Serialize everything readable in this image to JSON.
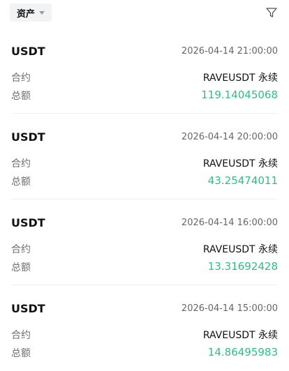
{
  "toolbar": {
    "filter_label": "资产"
  },
  "labels": {
    "contract": "合约",
    "amount": "总额"
  },
  "colors": {
    "positive": "#2ebd85"
  },
  "icons": {
    "filter": "funnel-icon",
    "dropdown": "chevron-down-icon"
  },
  "records": [
    {
      "coin": "USDT",
      "time": "2026-04-14 21:00:00",
      "contract": "RAVEUSDT 永续",
      "amount": "119.14045068"
    },
    {
      "coin": "USDT",
      "time": "2026-04-14 20:00:00",
      "contract": "RAVEUSDT 永续",
      "amount": "43.25474011"
    },
    {
      "coin": "USDT",
      "time": "2026-04-14 16:00:00",
      "contract": "RAVEUSDT 永续",
      "amount": "13.31692428"
    },
    {
      "coin": "USDT",
      "time": "2026-04-14 15:00:00",
      "contract": "RAVEUSDT 永续",
      "amount": "14.86495983"
    }
  ]
}
